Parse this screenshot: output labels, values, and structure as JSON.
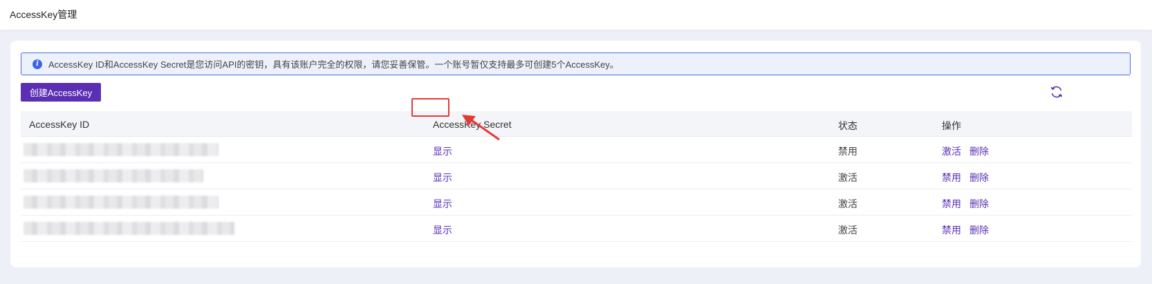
{
  "header": {
    "title": "AccessKey管理"
  },
  "alert": {
    "text": "AccessKey ID和AccessKey Secret是您访问API的密钥，具有该账户完全的权限，请您妥善保管。一个账号暂仅支持最多可创建5个AccessKey。",
    "icon": "info-icon"
  },
  "toolbar": {
    "create_label": "创建AccessKey",
    "refresh_icon": "refresh-icon"
  },
  "table": {
    "headers": [
      "AccessKey ID",
      "AccessKey Secret",
      "状态",
      "操作"
    ],
    "rows": [
      {
        "secret_action": "显示",
        "status": "禁用",
        "toggle_action": "激活",
        "delete_action": "删除"
      },
      {
        "secret_action": "显示",
        "status": "激活",
        "toggle_action": "禁用",
        "delete_action": "删除"
      },
      {
        "secret_action": "显示",
        "status": "激活",
        "toggle_action": "禁用",
        "delete_action": "删除"
      },
      {
        "secret_action": "显示",
        "status": "激活",
        "toggle_action": "禁用",
        "delete_action": "删除"
      }
    ]
  },
  "colors": {
    "accent": "#5a2fb3",
    "annotation": "#e53935",
    "alert_border": "#4a6dd6"
  }
}
